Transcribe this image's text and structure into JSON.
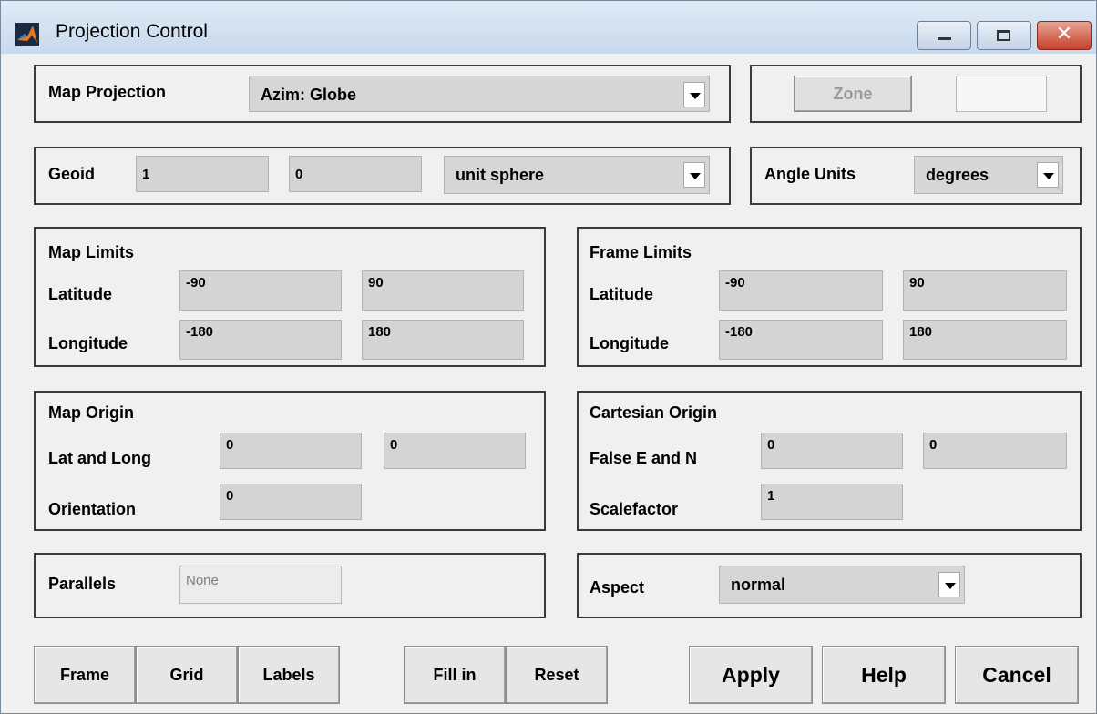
{
  "window": {
    "title": "Projection Control",
    "close_glyph": "✕"
  },
  "map_projection": {
    "label": "Map Projection",
    "value": "Azim: Globe"
  },
  "zone": {
    "button_label": "Zone",
    "value": ""
  },
  "geoid": {
    "label": "Geoid",
    "semimajor": "1",
    "eccentricity": "0",
    "ellipsoid": "unit sphere"
  },
  "angle_units": {
    "label": "Angle Units",
    "value": "degrees"
  },
  "map_limits": {
    "title": "Map Limits",
    "latitude_label": "Latitude",
    "longitude_label": "Longitude",
    "lat_min": "-90",
    "lat_max": "90",
    "lon_min": "-180",
    "lon_max": "180"
  },
  "frame_limits": {
    "title": "Frame Limits",
    "latitude_label": "Latitude",
    "longitude_label": "Longitude",
    "lat_min": "-90",
    "lat_max": "90",
    "lon_min": "-180",
    "lon_max": "180"
  },
  "map_origin": {
    "title": "Map Origin",
    "latlong_label": "Lat and Long",
    "orientation_label": "Orientation",
    "lat": "0",
    "long": "0",
    "orientation": "0"
  },
  "cartesian_origin": {
    "title": "Cartesian Origin",
    "false_en_label": "False E and N",
    "scalefactor_label": "Scalefactor",
    "false_e": "0",
    "false_n": "0",
    "scalefactor": "1"
  },
  "parallels": {
    "label": "Parallels",
    "value": "None"
  },
  "aspect": {
    "label": "Aspect",
    "value": "normal"
  },
  "buttons": {
    "frame": "Frame",
    "grid": "Grid",
    "labels": "Labels",
    "fill_in": "Fill in",
    "reset": "Reset",
    "apply": "Apply",
    "help": "Help",
    "cancel": "Cancel"
  },
  "colors": {
    "titlebar": "#c8d9ec",
    "close_button": "#c6412a",
    "panel_bg": "#f0f0f0",
    "field_bg": "#d4d4d4"
  }
}
